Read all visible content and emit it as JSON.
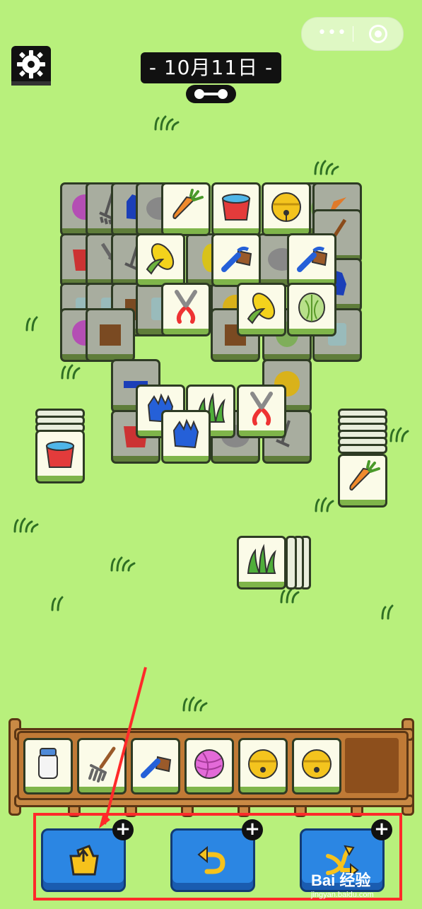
{
  "top_bar": {
    "date": "- 10月11日 -",
    "capsule_more": "•••",
    "icons": [
      "gear-icon",
      "key-icon",
      "more-icon",
      "target-icon"
    ]
  },
  "board": {
    "tiles_visible": [
      "carrot",
      "bucket",
      "bell",
      "corn",
      "brush",
      "corn",
      "clippers",
      "corn",
      "cabbage",
      "glove",
      "grass",
      "clippers",
      "bucket",
      "carrot",
      "grass"
    ],
    "hidden_tiles": [
      "yarn",
      "rake",
      "glove",
      "rock",
      "cabbage",
      "carrot",
      "bucket",
      "shovel",
      "glove",
      "corn",
      "clippers",
      "rock",
      "brush",
      "jar",
      "stump",
      "yarn",
      "stump",
      "jar",
      "brush",
      "bell",
      "rake"
    ]
  },
  "tray": {
    "slots": [
      "milk-jar",
      "rake",
      "brush",
      "yarn",
      "bell",
      "bell"
    ],
    "capacity": 7
  },
  "tools": [
    {
      "name": "move-out",
      "icon": "tile-out-icon",
      "badge": "+"
    },
    {
      "name": "undo",
      "icon": "undo-icon",
      "badge": "+"
    },
    {
      "name": "shuffle",
      "icon": "shuffle-icon",
      "badge": "+"
    }
  ],
  "watermark": {
    "line1": "Bai 经验",
    "line2": "jingyan.baidu.com"
  },
  "colors": {
    "background": "#b8f07c",
    "tile_face": "#fbfbe8",
    "tile_base": "#7fb54a",
    "button": "#2b86e3",
    "highlight": "#ff2a2a"
  }
}
